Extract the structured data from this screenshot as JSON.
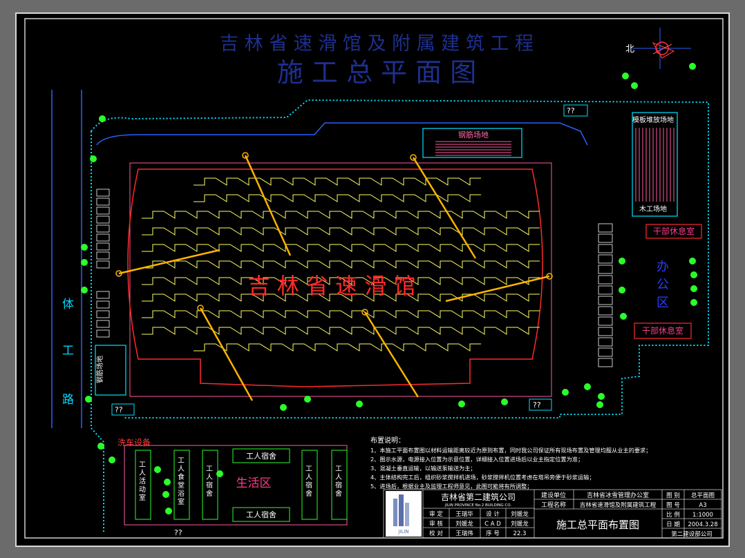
{
  "header": {
    "project_title": "吉 林 省 速 滑 馆 及 附 属 建 筑 工 程",
    "drawing_title": "施 工 总 平 面 图"
  },
  "north_label": "北",
  "left_road_label": [
    "体",
    "工",
    "路"
  ],
  "rink_label": "吉 林 省 速 滑 馆",
  "office_zone_label": [
    "办",
    "公",
    "区"
  ],
  "living_zone_label": "生活区",
  "yards": {
    "rebar_top": "钢筋场地",
    "rebar_left": "钢筋场地",
    "formwork": "模板堆放场地",
    "timber": "木工场地"
  },
  "rooms": {
    "staff_rest_1": "干部休息室",
    "staff_rest_2": "干部休息室",
    "car_wash": "洗车设备",
    "worker_activity": "工人活动室",
    "worker_canteen": "工人食堂浴室",
    "worker_dorm_top": "工人宿舍",
    "worker_dorm_bottom": "工人宿舍",
    "worker_dorm_v": "工人宿舍"
  },
  "gate_labels": [
    "??",
    "??",
    "??",
    "??"
  ],
  "notes": {
    "heading": "布置说明：",
    "items": [
      "1、本施工平面布置图以材料运输距离较近为原则布置，同时我公司保证所有现场布置及管理均服从业主的要求；",
      "2、图示水源，电源接入位置为示意位置，详细接入位置进场后以业主指定位置为准；",
      "3、混凝土垂直运输，以输送泵输送为主；",
      "4、主体结构完工后，组织砂浆搅拌机进场，砂浆搅拌机位置考虑在塔吊旁便于砂浆运输；",
      "5、进场后，根据业主及监理工程师意见，此图可能将有所调整；"
    ]
  },
  "title_block": {
    "company": "吉林省第二建筑公司",
    "company_en": "JILIN PROVINCE No.2 BUILDING CO.",
    "logo_text": "JILIN",
    "signoff": [
      {
        "role": "审 定",
        "name": "王瑞华",
        "role2": "设 计",
        "name2": "刘媛龙"
      },
      {
        "role": "审 核",
        "name": "刘媛龙",
        "role2": "C A D",
        "name2": "刘媛龙"
      },
      {
        "role": "校 对",
        "name": "王瑞伟",
        "role2": "序 号",
        "name2": "22.3"
      }
    ],
    "client_label": "建设单位",
    "client_value": "吉林省冰雪管理办公室",
    "project_label": "工程名称",
    "project_value": "吉林省速滑馆及附属建筑工程",
    "drawing_name": "施工总平面布置图",
    "meta": [
      {
        "label": "图 别",
        "value": "总平面图"
      },
      {
        "label": "图 号",
        "value": "A3"
      },
      {
        "label": "比 例",
        "value": "1:1000"
      },
      {
        "label": "日 期",
        "value": "2004.3.28"
      }
    ],
    "footer": "第二建设部公司"
  },
  "colors": {
    "background": "#000000",
    "fence": "#00e5ff",
    "building_outline": "#ff2a2a",
    "tiers": "#ffff66",
    "crane": "#ffb400",
    "dashed_title": "#1e2f8f",
    "site_labels": "#ff3a8c",
    "office_text": "#2a3cff",
    "trees": "#2aff2a"
  }
}
